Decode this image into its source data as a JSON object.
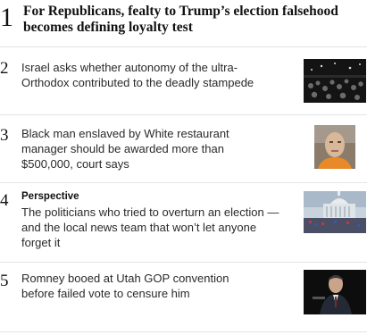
{
  "most_read": [
    {
      "rank": "1",
      "headline": "For Republicans, fealty to Trump’s election falsehood becomes defining loyalty test"
    },
    {
      "rank": "2",
      "headline": "Israel asks whether autonomy of the ultra-Orthodox contributed to the deadly stampede",
      "thumbnail": "crowd-at-night-photo"
    },
    {
      "rank": "3",
      "headline": "Black man enslaved by White restaurant manager should be awarded more than $500,000, court says",
      "thumbnail": "man-portrait-photo"
    },
    {
      "rank": "4",
      "kicker": "Perspective",
      "headline": "The politicians who tried to overturn an election — and the local news team that won’t let anyone forget it",
      "thumbnail": "capitol-crowd-photo"
    },
    {
      "rank": "5",
      "headline": "Romney booed at Utah GOP convention before failed vote to censure him",
      "thumbnail": "romney-speaking-photo"
    }
  ]
}
